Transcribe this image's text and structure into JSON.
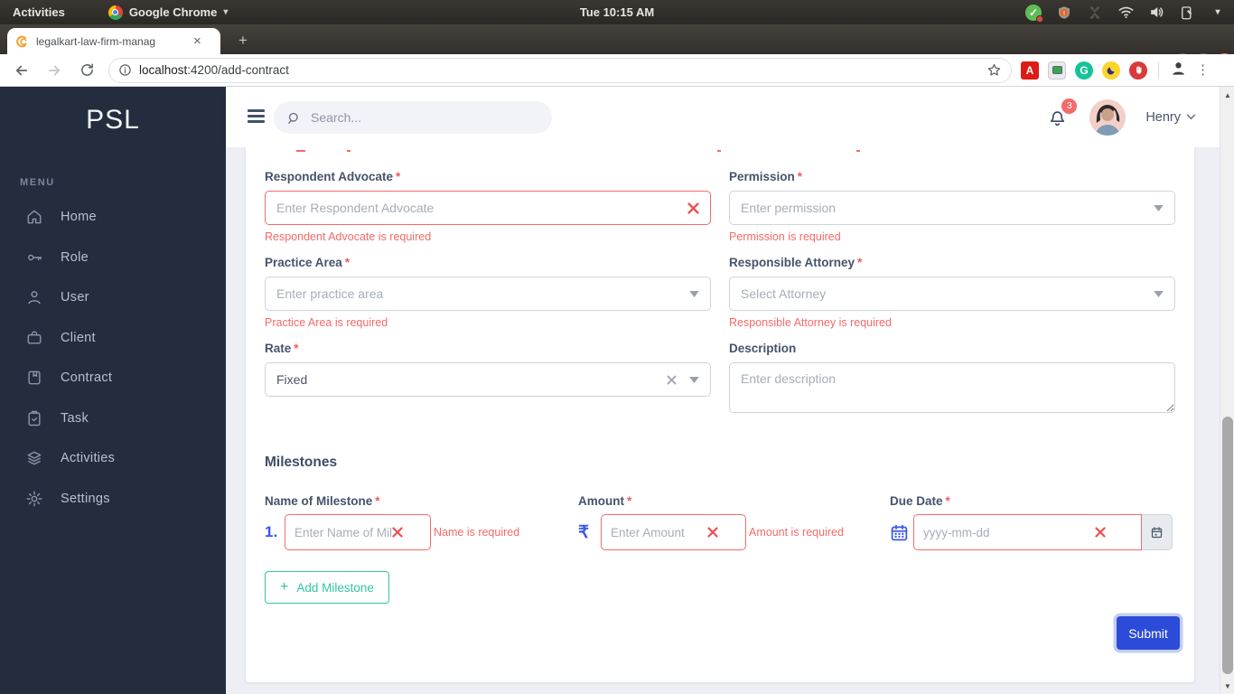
{
  "os_bar": {
    "activities": "Activities",
    "app_menu": "Google Chrome",
    "clock": "Tue 10:15 AM"
  },
  "browser": {
    "tab_title": "legalkart-law-firm-manag",
    "new_tab_label": "+",
    "url_scheme": "localhost",
    "url_rest": ":4200/add-contract"
  },
  "sidebar": {
    "logo": "PSL",
    "menu_label": "MENU",
    "items": [
      {
        "label": "Home"
      },
      {
        "label": "Role"
      },
      {
        "label": "User"
      },
      {
        "label": "Client"
      },
      {
        "label": "Contract"
      },
      {
        "label": "Task"
      },
      {
        "label": "Activities"
      },
      {
        "label": "Settings"
      }
    ]
  },
  "header": {
    "search_placeholder": "Search...",
    "notification_count": "3",
    "user_name": "Henry"
  },
  "form": {
    "fields": {
      "respondent_advocate": {
        "label": "Respondent Advocate",
        "required": "*",
        "placeholder": "Enter Respondent Advocate",
        "error": "Respondent Advocate is required"
      },
      "permission": {
        "label": "Permission",
        "required": "*",
        "placeholder": "Enter permission",
        "error": "Permission is required"
      },
      "practice_area": {
        "label": "Practice Area",
        "required": "*",
        "placeholder": "Enter practice area",
        "error": "Practice Area is required"
      },
      "responsible_attorney": {
        "label": "Responsible Attorney",
        "required": "*",
        "placeholder": "Select Attorney",
        "error": "Responsible Attorney is required"
      },
      "rate": {
        "label": "Rate",
        "required": "*",
        "value": "Fixed"
      },
      "description": {
        "label": "Description",
        "placeholder": "Enter description"
      }
    },
    "milestones": {
      "heading": "Milestones",
      "row_number": "1.",
      "currency_symbol": "₹",
      "name": {
        "label": "Name of Milestone",
        "required": "*",
        "placeholder": "Enter Name of Milestone",
        "error": "Name is required"
      },
      "amount": {
        "label": "Amount",
        "required": "*",
        "placeholder": "Enter Amount",
        "error": "Amount is required"
      },
      "due_date": {
        "label": "Due Date",
        "required": "*",
        "placeholder": "yyyy-mm-dd"
      },
      "add_icon": "+",
      "add_label": "Add Milestone"
    },
    "submit_label": "Submit"
  },
  "colors": {
    "error_red": "#f46a6a",
    "accent_blue": "#3a57e8",
    "submit_blue": "#2b4bd8",
    "teal": "#2fc7a4",
    "sidebar_bg": "#232d3e"
  }
}
